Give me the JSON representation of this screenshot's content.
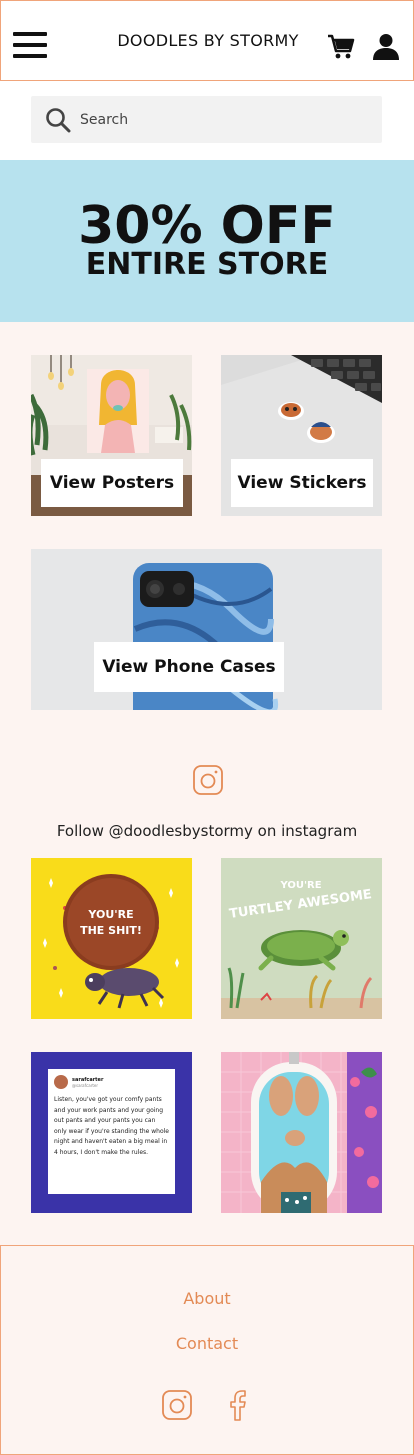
{
  "header": {
    "brand": "DOODLES BY STORMY"
  },
  "search": {
    "placeholder": "Search"
  },
  "promo": {
    "line1": "30% OFF",
    "line2": "ENTIRE STORE"
  },
  "categories": {
    "posters": "View Posters",
    "stickers": "View Stickers",
    "phone_cases": "View Phone Cases"
  },
  "instagram": {
    "follow_text": "Follow @doodlesbystormy on instagram",
    "posts": {
      "p1_text": "YOU'RE THE SHIT!",
      "p2_text_line1": "YOU'RE",
      "p2_text_line2": "TURTLEY AWESOME",
      "tweet_name": "sarafcarter",
      "tweet_handle": "@sarafcarter",
      "tweet_body": "Listen, you've got your comfy pants and your work pants and your going out pants and your pants you can only wear if you're standing the whole night and haven't eaten a big meal in 4 hours, I don't make the rules."
    }
  },
  "footer": {
    "about": "About",
    "contact": "Contact"
  },
  "colors": {
    "accent": "#e38a55",
    "promo_bg": "#b7e2ee",
    "page_bg": "#fdf4f1"
  }
}
